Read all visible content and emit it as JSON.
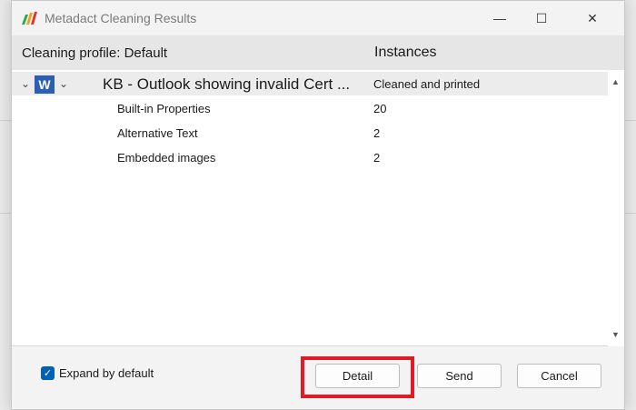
{
  "window": {
    "title": "Metadact Cleaning Results",
    "minimize_glyph": "—",
    "maximize_glyph": "☐",
    "close_glyph": "✕"
  },
  "header": {
    "profile": "Cleaning profile: Default",
    "instances": "Instances"
  },
  "document": {
    "icon_letter": "W",
    "title": "KB - Outlook showing invalid Cert ...",
    "status": "Cleaned and printed",
    "items": [
      {
        "label": "Built-in Properties",
        "value": "20"
      },
      {
        "label": "Alternative Text",
        "value": "2"
      },
      {
        "label": "Embedded images",
        "value": "2"
      }
    ]
  },
  "footer": {
    "expand_label": "Expand by default",
    "expand_checked": true,
    "detail_label": "Detail",
    "send_label": "Send",
    "cancel_label": "Cancel"
  },
  "colors": {
    "accent": "#005fb8",
    "word_blue": "#2b5fb3",
    "highlight": "#e01b24"
  }
}
